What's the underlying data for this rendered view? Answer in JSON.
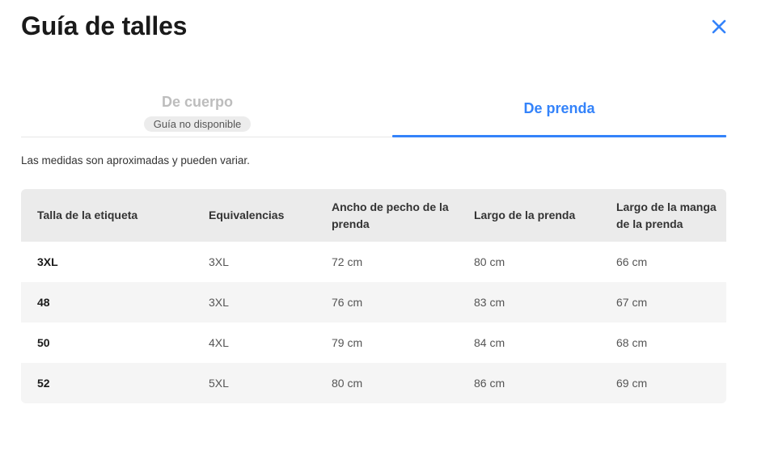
{
  "modal": {
    "title": "Guía de talles",
    "close_icon": "close-icon",
    "accent_color": "#3483fa"
  },
  "tabs": [
    {
      "label": "De cuerpo",
      "badge": "Guía no disponible",
      "state": "disabled"
    },
    {
      "label": "De prenda",
      "state": "active"
    }
  ],
  "disclaimer": "Las medidas son aproximadas y pueden variar.",
  "table": {
    "headers": [
      "Talla de la etiqueta",
      "Equivalencias",
      "Ancho de pecho de la prenda",
      "Largo de la prenda",
      "Largo de la manga de la prenda"
    ],
    "rows": [
      [
        "3XL",
        "3XL",
        "72 cm",
        "80 cm",
        "66 cm"
      ],
      [
        "48",
        "3XL",
        "76 cm",
        "83 cm",
        "67 cm"
      ],
      [
        "50",
        "4XL",
        "79 cm",
        "84 cm",
        "68 cm"
      ],
      [
        "52",
        "5XL",
        "80 cm",
        "86 cm",
        "69 cm"
      ]
    ]
  }
}
